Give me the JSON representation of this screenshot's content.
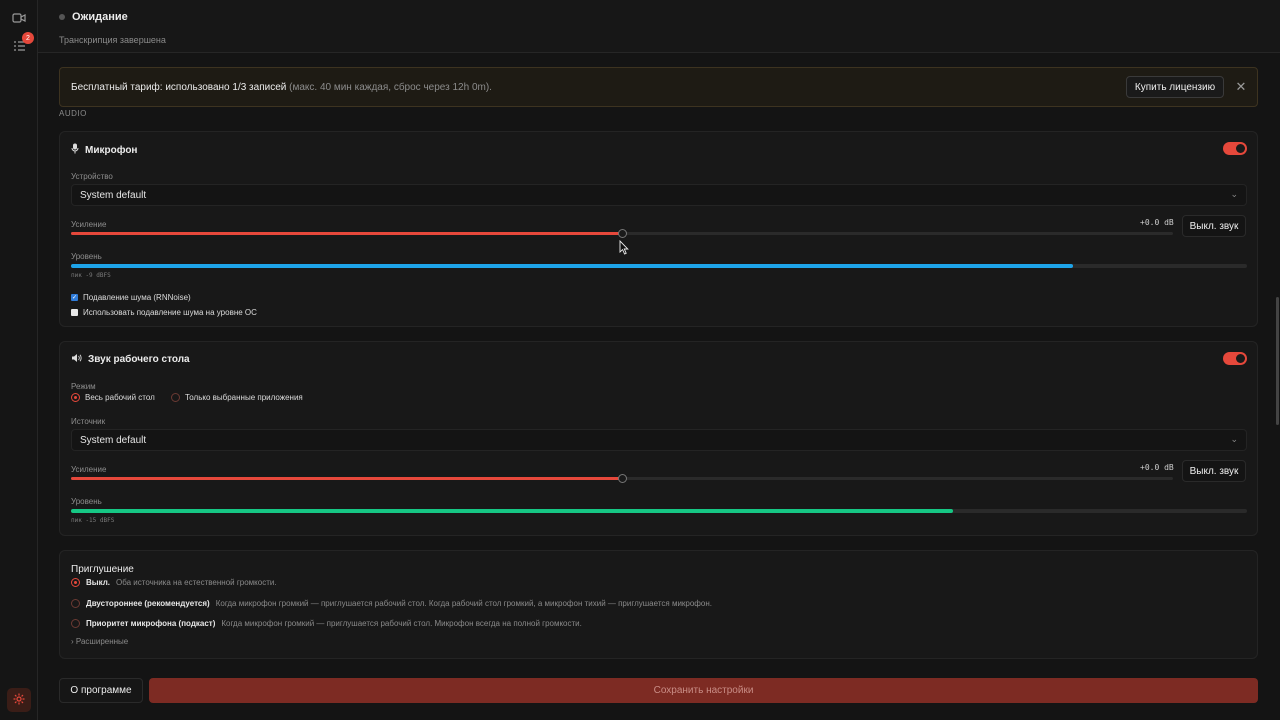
{
  "sidebar": {
    "items": [
      {
        "icon": "video-camera-icon",
        "badge": ""
      },
      {
        "icon": "checklist-icon",
        "badge": "2"
      }
    ],
    "settings_icon": "gear-icon"
  },
  "header": {
    "status_title": "Ожидание",
    "status_sub": "Транскрипция завершена"
  },
  "banner": {
    "text_main": "Бесплатный тариф: использовано 1/3 записей",
    "text_muted": " (макс. 40 мин каждая, сброс через 12h 0m).",
    "buy_label": "Купить лицензию",
    "close_glyph": "✕"
  },
  "section_label": "AUDIO",
  "microphone": {
    "title": "Микрофон",
    "enabled": true,
    "device_label": "Устройство",
    "device_value": "System default",
    "gain_label": "Усиление",
    "gain_value": "+0.0 dB",
    "gain_fraction": 0.5,
    "mute_label": "Выкл. звук",
    "level_label": "Уровень",
    "level_fraction": 0.852,
    "peak": "пик -9 dBFS",
    "noise_suppression_label": "Подавление шума (RNNoise)",
    "noise_suppression_checked": true,
    "os_noise_label": "Использовать подавление шума на уровне ОС",
    "os_noise_checked": false
  },
  "desktop": {
    "title": "Звук рабочего стола",
    "enabled": true,
    "mode_label": "Режим",
    "mode_options": [
      "Весь рабочий стол",
      "Только выбранные приложения"
    ],
    "mode_selected": 0,
    "source_label": "Источник",
    "source_value": "System default",
    "gain_label": "Усиление",
    "gain_value": "+0.0 dB",
    "gain_fraction": 0.5,
    "mute_label": "Выкл. звук",
    "level_label": "Уровень",
    "level_fraction": 0.75,
    "peak": "пик -15 dBFS"
  },
  "ducking": {
    "title": "Приглушение",
    "options": [
      {
        "name": "Выкл.",
        "desc": "Оба источника на естественной громкости.",
        "selected": true
      },
      {
        "name": "Двустороннее (рекомендуется)",
        "desc": "Когда микрофон громкий — приглушается рабочий стол. Когда рабочий стол громкий, а микрофон тихий — приглушается микрофон.",
        "selected": false
      },
      {
        "name": "Приоритет микрофона (подкаст)",
        "desc": "Когда микрофон громкий — приглушается рабочий стол. Микрофон всегда на полной громкости.",
        "selected": false
      }
    ],
    "advanced_label": "Расширенные"
  },
  "footer": {
    "about_label": "О программе",
    "save_label": "Сохранить настройки"
  },
  "colors": {
    "accent": "#e5483b",
    "mic_level": "#1ea4e9",
    "desktop_level": "#16c784"
  }
}
